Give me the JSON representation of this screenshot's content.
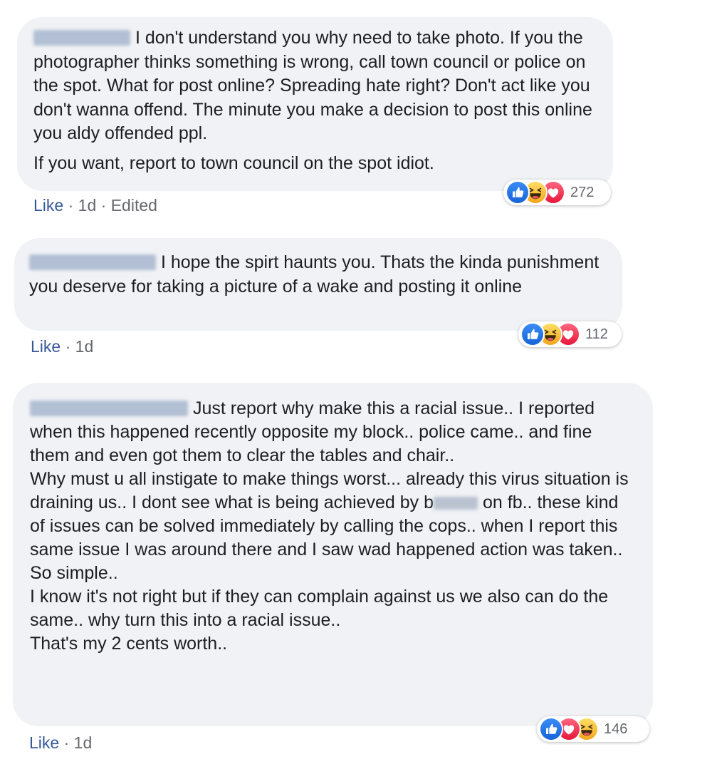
{
  "comments": [
    {
      "paragraphs": [
        "I don't understand you why need to take photo. If you the photographer thinks something is wrong, call town council or police on the spot. What for post online? Spreading hate right? Don't act like you don't wanna offend. The minute you make a decision to post this online you aldy offended ppl.",
        "If you want, report to town council on the spot idiot."
      ],
      "like_label": "Like",
      "separator": " · ",
      "time": "1d",
      "edited": "Edited",
      "reactions": [
        "like-icon",
        "haha-icon",
        "love-icon"
      ],
      "reaction_count": "272"
    },
    {
      "text": "I hope the spirt haunts you. Thats the kinda punishment you deserve for taking a picture of a wake and posting it online",
      "like_label": "Like",
      "separator": " · ",
      "time": "1d",
      "reactions": [
        "like-icon",
        "haha-icon",
        "love-icon"
      ],
      "reaction_count": "112"
    },
    {
      "lines": [
        "Just report why make this a racial issue.. I reported when this happened recently opposite my block.. police came.. and fine them and even got them to clear the tables and chair..",
        "Why must u all instigate to make things worst... already this virus situation is draining us.. I dont see what is being achieved by",
        "on fb.. these kind of issues can be solved immediately by calling the cops.. when I report this same issue I was around there and I saw wad happened action was taken..",
        "So simple..",
        "I know it's not right but if they can complain against us we also can do the same.. why turn this into a racial issue..",
        "That's my 2 cents worth.."
      ],
      "blurred_word_prefix": "b",
      "like_label": "Like",
      "separator": " · ",
      "time": "1d",
      "reactions": [
        "like-icon",
        "love-icon",
        "haha-icon"
      ],
      "reaction_count": "146"
    }
  ],
  "colors": {
    "bubble": "#f0f2f5",
    "like_link": "#385898",
    "meta_text": "#65676b",
    "like_reaction": "#1877f2",
    "love_reaction": "#f33e58",
    "haha_reaction": "#f7b125"
  }
}
